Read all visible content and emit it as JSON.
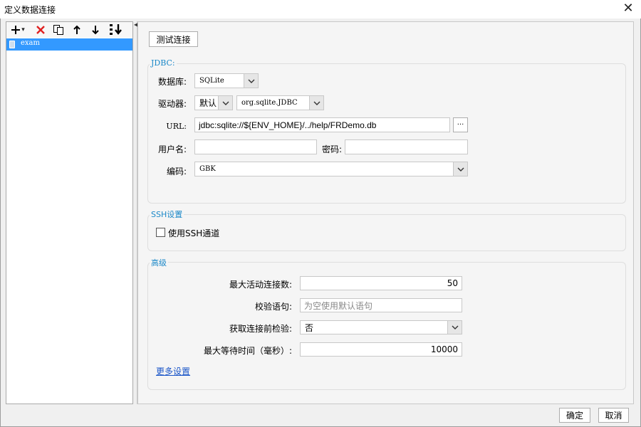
{
  "window": {
    "title": "定义数据连接"
  },
  "toolbar": {
    "add_dropdown": "▾"
  },
  "connections": [
    {
      "name": "exam",
      "selected": true
    }
  ],
  "test_button": "测试连接",
  "jdbc": {
    "group_title": "JDBC:",
    "database_label": "数据库:",
    "database_value": "SQLite",
    "driver_label": "驱动器:",
    "driver_mode": "默认",
    "driver_class": "org.sqlite.JDBC",
    "url_label": "URL:",
    "url_value": "jdbc:sqlite://${ENV_HOME}/../help/FRDemo.db",
    "url_more": "···",
    "username_label": "用户名:",
    "username_value": "",
    "password_label": "密码:",
    "password_value": "",
    "encoding_label": "编码:",
    "encoding_value": "GBK"
  },
  "ssh": {
    "group_title": "SSH设置",
    "use_ssh_label": "使用SSH通道",
    "use_ssh_checked": false
  },
  "advanced": {
    "group_title": "高级",
    "max_active_label": "最大活动连接数:",
    "max_active_value": "50",
    "validation_label": "校验语句:",
    "validation_placeholder": "为空使用默认语句",
    "test_before_label": "获取连接前检验:",
    "test_before_value": "否",
    "max_wait_label": "最大等待时间（毫秒）:",
    "max_wait_value": "10000",
    "more_settings": "更多设置"
  },
  "footer": {
    "ok_label": "确定",
    "cancel_label": "取消"
  },
  "colors": {
    "accent": "#1b88c8",
    "selection": "#3399ff",
    "delete": "#e02020",
    "link": "#1a55c8"
  }
}
